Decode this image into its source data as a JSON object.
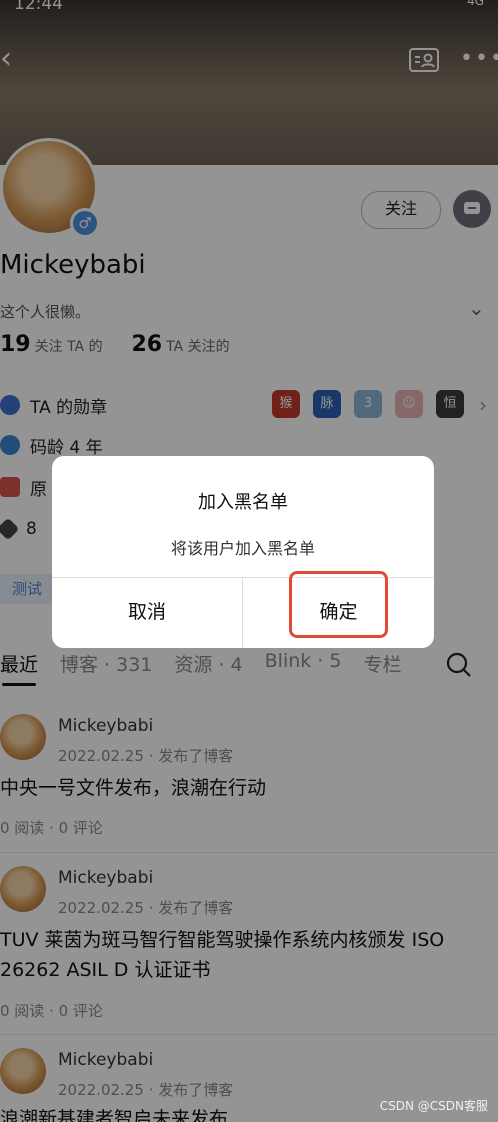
{
  "status": {
    "time": "12:44",
    "network": "4G"
  },
  "profile": {
    "username": "Mickeybabi",
    "bio": "这个人很懒。",
    "follow_label": "关注",
    "followers_count": "19",
    "followers_label": "关注 TA 的",
    "following_count": "26",
    "following_label": "TA 关注的"
  },
  "info_rows": [
    {
      "label": "TA 的勋章",
      "icon": "medal-star-icon"
    },
    {
      "label": "码龄 4 年",
      "icon": "eye-icon"
    },
    {
      "label": "原",
      "icon": "original-badge-icon"
    },
    {
      "label": "8",
      "icon": "level-icon"
    }
  ],
  "medals": [
    {
      "icon": "monkey-medal-icon",
      "glyph": "猴",
      "color": "#c0392b"
    },
    {
      "icon": "mai-medal-icon",
      "glyph": "脉",
      "color": "#2b5fb4"
    },
    {
      "icon": "level3-medal-icon",
      "glyph": "3",
      "color": "#8bb5d6"
    },
    {
      "icon": "mascot-medal-icon",
      "glyph": "☺",
      "color": "#e8b1b1"
    },
    {
      "icon": "hex-medal-icon",
      "glyph": "恒",
      "color": "#3b3b3b"
    }
  ],
  "tag": "测试",
  "tabs": [
    "最近",
    "博客 · 331",
    "资源 · 4",
    "Blink · 5",
    "专栏"
  ],
  "posts": [
    {
      "author": "Mickeybabi",
      "meta": "2022.02.25 · 发布了博客",
      "title": "中央一号文件发布，浪潮在行动",
      "stats": "0 阅读 · 0 评论"
    },
    {
      "author": "Mickeybabi",
      "meta": "2022.02.25 · 发布了博客",
      "title": "TUV 莱茵为斑马智行智能驾驶操作系统内核颁发 ISO 26262 ASIL D 认证证书",
      "stats": "0 阅读 · 0 评论"
    },
    {
      "author": "Mickeybabi",
      "meta": "2022.02.25 · 发布了博客",
      "title": "浪潮新基建者智启未来发布",
      "stats": ""
    }
  ],
  "dialog": {
    "title": "加入黑名单",
    "message": "将该用户加入黑名单",
    "cancel": "取消",
    "confirm": "确定"
  },
  "watermark": "CSDN @CSDN客服"
}
